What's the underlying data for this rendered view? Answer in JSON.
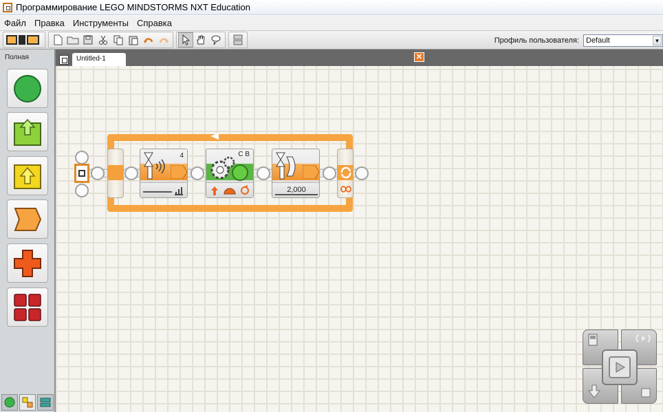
{
  "window": {
    "title": "Программирование LEGO MINDSTORMS NXT Education"
  },
  "menu": [
    {
      "label": "Файл"
    },
    {
      "label": "Правка"
    },
    {
      "label": "Инструменты"
    },
    {
      "label": "Справка"
    }
  ],
  "toolbar": {
    "profile_label": "Профиль пользователя:",
    "profile_value": "Default",
    "icons": [
      "nxt-window-icon",
      "new-file-icon",
      "open-folder-icon",
      "save-icon",
      "cut-icon",
      "copy-icon",
      "paste-icon",
      "undo-icon",
      "redo-icon",
      "pointer-icon",
      "pan-hand-icon",
      "comment-icon",
      "custom-palette-icon"
    ]
  },
  "palette": {
    "title": "Полная",
    "items": [
      {
        "name": "common-palette",
        "color": "#3bb34a"
      },
      {
        "name": "action-palette",
        "color": "#8fd13b"
      },
      {
        "name": "sensor-palette",
        "color": "#f2d620"
      },
      {
        "name": "flow-palette",
        "color": "#f6a441"
      },
      {
        "name": "data-palette",
        "color": "#ee5a1e"
      },
      {
        "name": "advanced-palette",
        "color": "#c8262a"
      }
    ]
  },
  "document": {
    "tab_label": "Untitled-1"
  },
  "program": {
    "sound_block_port": "4",
    "motor_block_ports": "C B",
    "wait_block_value": "2,000"
  },
  "colors": {
    "loop_orange": "#f6a441",
    "motor_green": "#5cb646",
    "canvas": "#f6f4ee",
    "sidebar": "#d4d7d9"
  }
}
